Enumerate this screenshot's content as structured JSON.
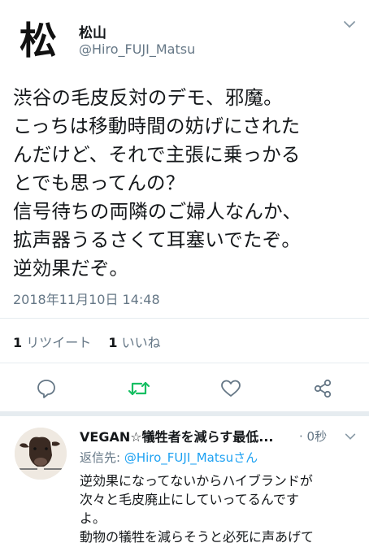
{
  "tweet": {
    "avatar_glyph": "松",
    "display_name": "松山",
    "handle": "@Hiro_FUJI_Matsu",
    "lines": [
      "渋谷の毛皮反対のデモ、邪魔。",
      "こっちは移動時間の妨げにされた",
      "んだけど、それで主張に乗っかる",
      "とでも思ってんの？",
      "信号待ちの両隣のご婦人なんか、",
      "拡声器うるさくて耳塞いでたぞ。",
      "逆効果だぞ。"
    ],
    "timestamp": "2018年11月10日 14:48",
    "retweet_count": "1",
    "retweet_label": "リツイート",
    "like_count": "1",
    "like_label": "いいね"
  },
  "actions": {
    "reply_icon": "comment-icon",
    "retweet_icon": "retweet-icon",
    "like_icon": "heart-icon",
    "share_icon": "share-icon"
  },
  "reply": {
    "display_name": "VEGAN☆犠牲者を減らす最低...",
    "time": "· 0秒",
    "to_label": "返信先: ",
    "to_mention": "@Hiro_FUJI_Matsuさん",
    "lines": [
      "逆効果になってないからハイブランドが",
      "次々と毛皮廃止にしていってるんです",
      "よ。",
      "動物の犠牲を減らそうと必死に声あげて"
    ]
  },
  "colors": {
    "accent": "#1da1f2",
    "retweet_green": "#17bf63",
    "secondary_text": "#657786",
    "separator": "#e6ecf0"
  }
}
